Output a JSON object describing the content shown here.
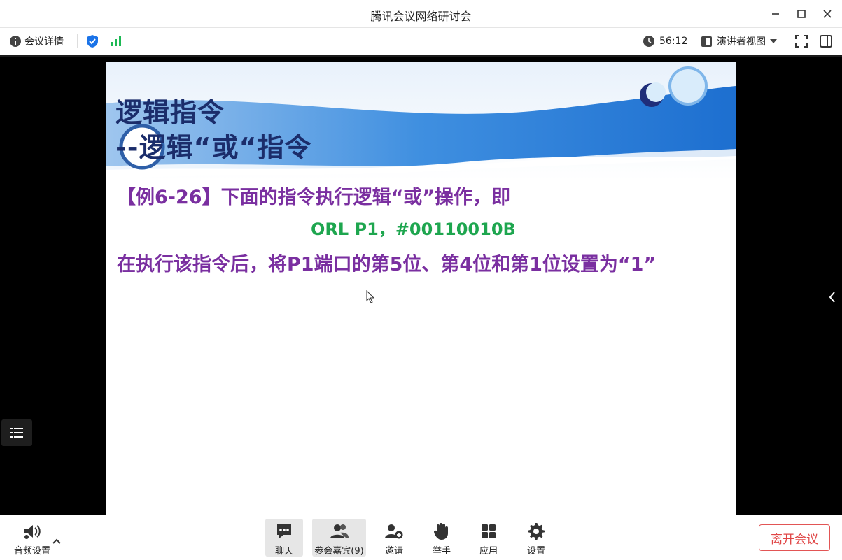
{
  "window": {
    "title": "腾讯会议网络研讨会"
  },
  "toolbar": {
    "meeting_details": "会议详情",
    "timer": "56:12",
    "view_mode": "演讲者视图"
  },
  "slide": {
    "title_line1": "逻辑指令",
    "title_line2": "--逻辑“或“指令",
    "line1": "【例6-26】下面的指令执行逻辑“或”操作，即",
    "code": "ORL P1，#00110010B",
    "line3": "在执行该指令后，将P1端口的第5位、第4位和第1位设置为“1”"
  },
  "bottom": {
    "audio_settings": "音频设置",
    "chat": "聊天",
    "participants": "参会嘉宾(9)",
    "invite": "邀请",
    "raise_hand": "举手",
    "apps": "应用",
    "settings": "设置",
    "leave": "离开会议"
  },
  "colors": {
    "accent_blue": "#1a73e8",
    "signal_green": "#1db954",
    "slide_title": "#1b2d6b",
    "slide_text_purple": "#7a2fa0",
    "slide_code_green": "#1ea64f",
    "leave_red": "#e04545"
  }
}
